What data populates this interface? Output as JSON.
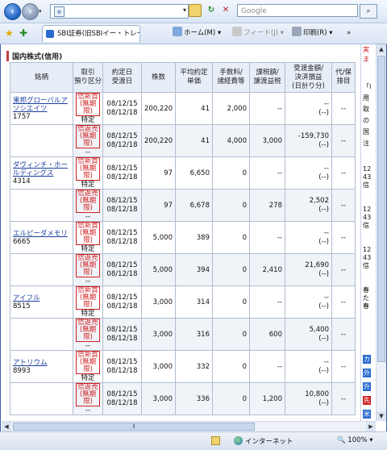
{
  "toolbar": {
    "back_icon": "back-arrow-icon",
    "forward_icon": "forward-arrow-icon",
    "address_value": "",
    "search_placeholder": "Google",
    "search_icon": "search-icon"
  },
  "tabs": {
    "active_tab_label": "SBI証券(旧SBIイー・トレー…",
    "home_label": "ホーム(M)",
    "feed_label": "フィード(J)",
    "print_label": "印刷(R)"
  },
  "page": {
    "section_title": "国内株式(信用)"
  },
  "table": {
    "headers": {
      "name": "銘柄",
      "type": "取引\n預り区分",
      "dates": "約定日\n受渡日",
      "shares": "株数",
      "price": "平均約定\n単価",
      "fee": "手数料/\n諸経費等",
      "tax": "課税額/\n譲渡益税",
      "pl": "受渡金額/\n決済損益\n(日計り分)",
      "tail": "代/保\n排目"
    },
    "rows": [
      {
        "name": "東邦グローバルアソシエイツ",
        "code": "1757",
        "type": "信新買",
        "limit": "(無期限)",
        "acct": "特定",
        "dates": [
          "08/12/15",
          "08/12/18"
        ],
        "shares": "200,220",
        "price": "41",
        "fee": "2,000",
        "tax": "--",
        "pl": [
          "--",
          "(--)"
        ],
        "tail": "--"
      },
      {
        "name": "",
        "code": "",
        "type": "信返売",
        "limit": "(無期限)",
        "acct": "--",
        "dates": [
          "08/12/15",
          "08/12/18"
        ],
        "shares": "200,220",
        "price": "41",
        "fee": "4,000",
        "tax": "3,000",
        "pl": [
          "-159,730",
          "(--)"
        ],
        "tail": "--"
      },
      {
        "name": "ダヴィンチ・ホールディングス",
        "code": "4314",
        "type": "信新買",
        "limit": "(無期限)",
        "acct": "特定",
        "dates": [
          "08/12/15",
          "08/12/18"
        ],
        "shares": "97",
        "price": "6,650",
        "fee": "0",
        "tax": "--",
        "pl": [
          "--",
          "(--)"
        ],
        "tail": "--"
      },
      {
        "name": "",
        "code": "",
        "type": "信返売",
        "limit": "(無期限)",
        "acct": "--",
        "dates": [
          "08/12/15",
          "08/12/18"
        ],
        "shares": "97",
        "price": "6,678",
        "fee": "0",
        "tax": "278",
        "pl": [
          "2,502",
          "(--)"
        ],
        "tail": "--"
      },
      {
        "name": "エルピーダメモリ",
        "code": "6665",
        "type": "信新買",
        "limit": "(無期限)",
        "acct": "特定",
        "dates": [
          "08/12/15",
          "08/12/18"
        ],
        "shares": "5,000",
        "price": "389",
        "fee": "0",
        "tax": "--",
        "pl": [
          "--",
          "(--)"
        ],
        "tail": "--"
      },
      {
        "name": "",
        "code": "",
        "type": "信返売",
        "limit": "(無期限)",
        "acct": "--",
        "dates": [
          "08/12/15",
          "08/12/18"
        ],
        "shares": "5,000",
        "price": "394",
        "fee": "0",
        "tax": "2,410",
        "pl": [
          "21,690",
          "(--)"
        ],
        "tail": "--"
      },
      {
        "name": "アイフル",
        "code": "8515",
        "type": "信新買",
        "limit": "(無期限)",
        "acct": "特定",
        "dates": [
          "08/12/15",
          "08/12/18"
        ],
        "shares": "3,000",
        "price": "314",
        "fee": "0",
        "tax": "--",
        "pl": [
          "--",
          "(--)"
        ],
        "tail": "--"
      },
      {
        "name": "",
        "code": "",
        "type": "信返売",
        "limit": "(無期限)",
        "acct": "--",
        "dates": [
          "08/12/15",
          "08/12/18"
        ],
        "shares": "3,000",
        "price": "316",
        "fee": "0",
        "tax": "600",
        "pl": [
          "5,400",
          "(--)"
        ],
        "tail": "--"
      },
      {
        "name": "アトリウム",
        "code": "8993",
        "type": "信新買",
        "limit": "(無期限)",
        "acct": "特定",
        "dates": [
          "08/12/15",
          "08/12/18"
        ],
        "shares": "3,000",
        "price": "332",
        "fee": "0",
        "tax": "--",
        "pl": [
          "--",
          "(--)"
        ],
        "tail": "--"
      },
      {
        "name": "",
        "code": "",
        "type": "信返売",
        "limit": "(無期限)",
        "acct": "--",
        "dates": [
          "08/12/15",
          "08/12/18"
        ],
        "shares": "3,000",
        "price": "336",
        "fee": "0",
        "tax": "1,200",
        "pl": [
          "10,800",
          "(--)"
        ],
        "tail": "--"
      }
    ]
  },
  "right_pane": {
    "texts": [
      "実",
      "ま",
      "「I",
      "用",
      "取",
      "の",
      "国",
      "注",
      "12",
      "43",
      "信",
      "12",
      "43",
      "信",
      "12",
      "43",
      "信",
      "春",
      "た",
      "春",
      "カ",
      "外",
      "外",
      "先",
      "米"
    ]
  },
  "status_bar": {
    "zone_label": "インターネット",
    "zoom_label": "100%"
  },
  "colors": {
    "accent": "#1a3fa0",
    "sell_buy_red": "#d02020",
    "header_bg": "#e8eef8"
  }
}
